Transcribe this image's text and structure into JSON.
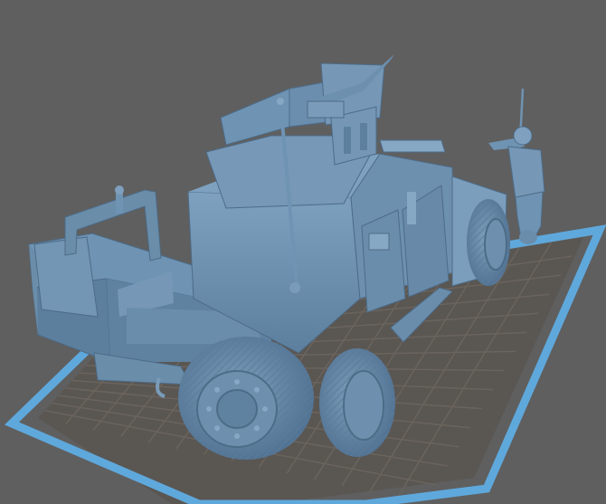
{
  "viewport": {
    "background_color": "#5f5f5f",
    "model_color": "#6f93b3",
    "model_shadow_color": "#4d6c88",
    "model_highlight_color": "#8db0cc",
    "grid_fill_color": "#5a5652",
    "grid_line_color": "#6b645d",
    "build_plate_border_color": "#5fa8dc"
  },
  "model": {
    "object": "armored-vehicle-with-soldier"
  }
}
